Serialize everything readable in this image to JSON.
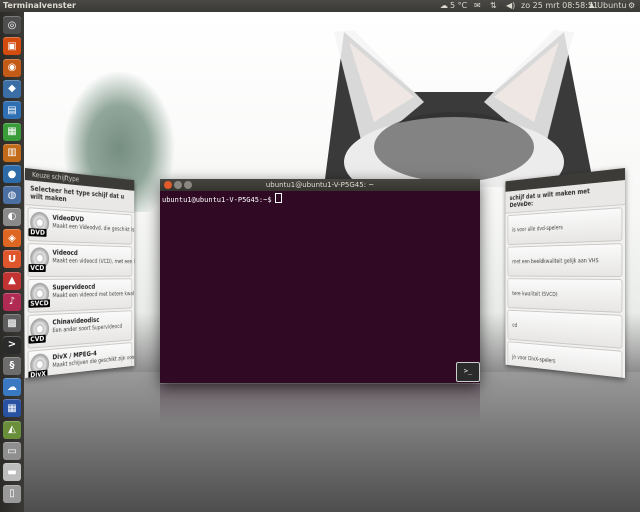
{
  "panel": {
    "title": "Terminalvenster",
    "weather": "5 °C",
    "datetime": "zo 25 mrt 08:58:51",
    "user": "Ubuntu"
  },
  "launcher": {
    "items": [
      {
        "name": "dash-home",
        "color": "#4e4e4e",
        "glyph": "◎"
      },
      {
        "name": "files",
        "color": "#d34c0e",
        "glyph": "▣"
      },
      {
        "name": "firefox",
        "color": "#c35a15",
        "glyph": "◉"
      },
      {
        "name": "virtualbox",
        "color": "#3a6ea5",
        "glyph": "◆"
      },
      {
        "name": "libreoffice-writer",
        "color": "#2f6fb3",
        "glyph": "▤"
      },
      {
        "name": "libreoffice-calc",
        "color": "#3a9b3a",
        "glyph": "▦"
      },
      {
        "name": "libreoffice-impress",
        "color": "#c06a1a",
        "glyph": "▥"
      },
      {
        "name": "thunderbird",
        "color": "#2c6aa8",
        "glyph": "●"
      },
      {
        "name": "settings",
        "color": "#4a6fa0",
        "glyph": "◍"
      },
      {
        "name": "devede",
        "color": "#8a8a8a",
        "glyph": "◐"
      },
      {
        "name": "ubuntu-software",
        "color": "#dd6622",
        "glyph": "◈"
      },
      {
        "name": "ubuntu-one",
        "color": "#e0562c",
        "glyph": "U"
      },
      {
        "name": "media-player",
        "color": "#c23434",
        "glyph": "▲"
      },
      {
        "name": "ubuntu-one-music",
        "color": "#b02a54",
        "glyph": "♪"
      },
      {
        "name": "workspace-switcher",
        "color": "#5e5e5e",
        "glyph": "▩"
      },
      {
        "name": "terminal",
        "color": "#2b2b2b",
        "glyph": ">"
      },
      {
        "name": "system-monitor",
        "color": "#6d6d6d",
        "glyph": "§"
      },
      {
        "name": "cloud-app",
        "color": "#3b78c2",
        "glyph": "☁"
      },
      {
        "name": "workspaces",
        "color": "#2952a3",
        "glyph": "▦"
      },
      {
        "name": "disk-utility",
        "color": "#6a8f3a",
        "glyph": "◭"
      },
      {
        "name": "drive",
        "color": "#8f8f8f",
        "glyph": "▭"
      },
      {
        "name": "printer",
        "color": "#bdbdbd",
        "glyph": "▬"
      },
      {
        "name": "trash",
        "color": "#9a9a9a",
        "glyph": "▯"
      }
    ]
  },
  "left_window": {
    "title": "Keuze schijftype",
    "subheading": "Selecteer het type schijf dat u wilt maken",
    "options": [
      {
        "tag": "DVD",
        "name": "VideoDVD",
        "desc": "Maakt een Videodvd, die geschikt is voor alle dvd-spelers"
      },
      {
        "tag": "VCD",
        "name": "Videocd",
        "desc": "Maakt een videocd (VCD), met een beeldkwaliteit"
      },
      {
        "tag": "SVCD",
        "name": "Supervideocd",
        "desc": "Maakt een videocd met betere kwaliteit (SVCD)"
      },
      {
        "tag": "CVD",
        "name": "Chinavideodisc",
        "desc": "Een ander soort Supervideocd"
      },
      {
        "tag": "DivX",
        "name": "DivX / MPEG-4",
        "desc": "Maakt schijven die geschikt zijn voor DivX-spelers"
      }
    ]
  },
  "right_window": {
    "subheading": "schijf dat u wilt maken met DeVeDe:",
    "options": [
      {
        "desc": "is voor alle dvd-spelers"
      },
      {
        "desc": "met een beeldkwaliteit gelijk aan VHS"
      },
      {
        "desc": "tere kwaliteit (SVCD)"
      },
      {
        "desc": "cd"
      },
      {
        "desc": "jn voor DivX-spelers"
      }
    ]
  },
  "terminal": {
    "title": "ubuntu1@ubuntu1-V-P5G45: ~",
    "prompt": "ubuntu1@ubuntu1-V-P5G45:~$",
    "badge": ">_"
  }
}
